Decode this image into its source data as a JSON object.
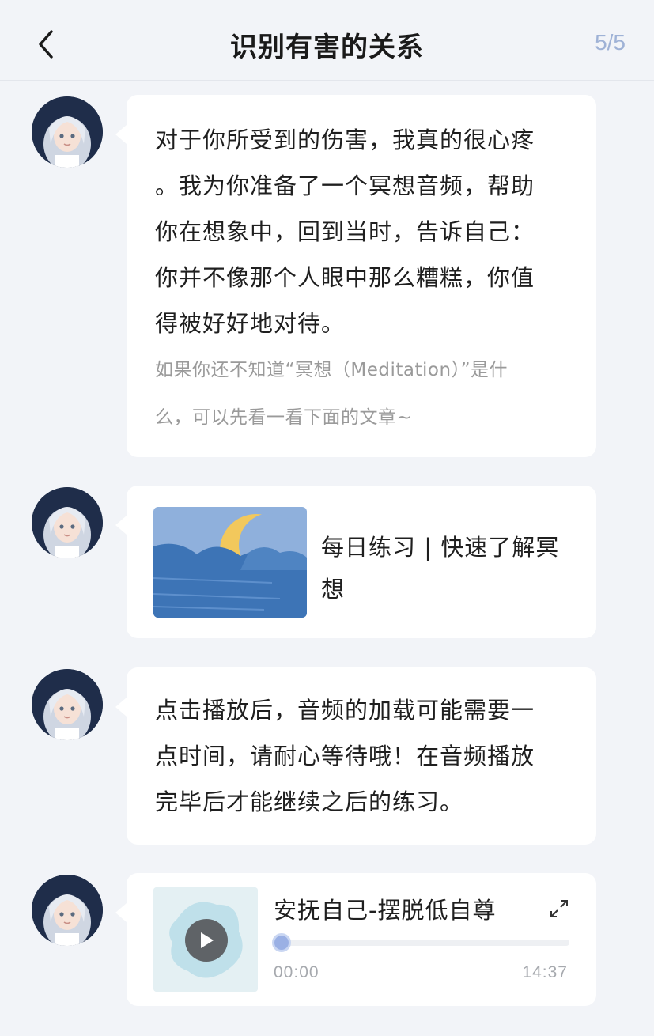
{
  "header": {
    "title": "识别有害的关系",
    "page_count": "5/5"
  },
  "messages": [
    {
      "type": "text",
      "main_lines": [
        "对于你所受到的伤害，我真的很心疼",
        "。我为你准备了一个冥想音频，帮助",
        "你在想象中，回到当时，告诉自己：",
        "你并不像那个人眼中那么糟糕，你值",
        "得被好好地对待。"
      ],
      "sub_lines": [
        "如果你还不知道“冥想（Meditation）”是什",
        "么，可以先看一看下面的文章~"
      ]
    },
    {
      "type": "article",
      "title_lines": [
        "每日练习 | 快速了解冥",
        "想"
      ]
    },
    {
      "type": "text",
      "main_lines": [
        "点击播放后，音频的加载可能需要一",
        "点时间，请耐心等待哦！在音频播放",
        "完毕后才能继续之后的练习。"
      ]
    },
    {
      "type": "audio",
      "title": "安抚自己-摆脱低自尊",
      "current_time": "00:00",
      "total_time": "14:37",
      "progress": 0
    }
  ],
  "colors": {
    "background": "#f2f4f8",
    "accent": "#9fb2d6",
    "progress_knob": "#9ab0e4"
  },
  "icons": [
    "back-arrow-icon",
    "play-icon",
    "expand-icon"
  ]
}
